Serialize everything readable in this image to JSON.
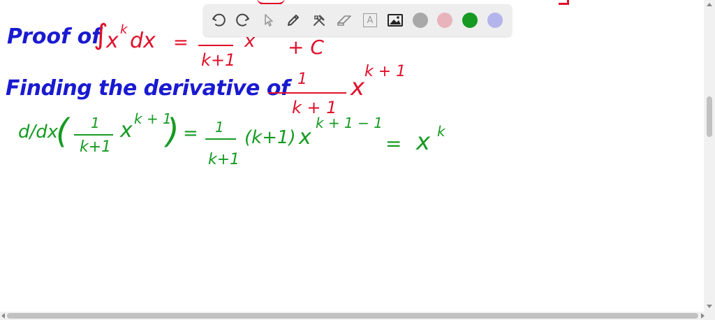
{
  "line1": {
    "prefix": "Proof of",
    "integral": "∫",
    "integrand": "x",
    "integrand_exp": "k",
    "dx": "dx",
    "equals": "=",
    "frac_den": "k+1",
    "power_base": "x",
    "plus_c": "+ C"
  },
  "line2": {
    "text": "Finding the derivative of",
    "frac_num": "1",
    "frac_den": "k + 1",
    "base": "x",
    "exp": "k + 1"
  },
  "line3": {
    "operator": "d/dx",
    "open_paren": "(",
    "frac_num": "1",
    "frac_den": "k+1",
    "base": "x",
    "exp": "k + 1",
    "close_paren": ")",
    "equals": "=",
    "rhs_frac_num": "1",
    "rhs_frac_den": "k+1",
    "factor": "(k+1)",
    "rhs_base": "x",
    "rhs_exp": "k + 1 − 1",
    "equals2": "=",
    "result_base": "x",
    "result_exp": "k"
  },
  "colors": {
    "blue": "#1a1ad0",
    "red": "#e0102a",
    "green": "#169a22",
    "toolbar_bg": "#eeeeee",
    "swatch_gray": "#a8a8a8",
    "swatch_pink": "#e8b4bc",
    "swatch_green": "#169a22",
    "swatch_lavender": "#b4b4ec"
  },
  "toolbar": {
    "icons": [
      "undo-icon",
      "redo-icon",
      "select-icon",
      "pen-icon",
      "tools-icon",
      "eraser-icon",
      "text-icon",
      "image-icon"
    ],
    "text_tool_label": "A"
  }
}
